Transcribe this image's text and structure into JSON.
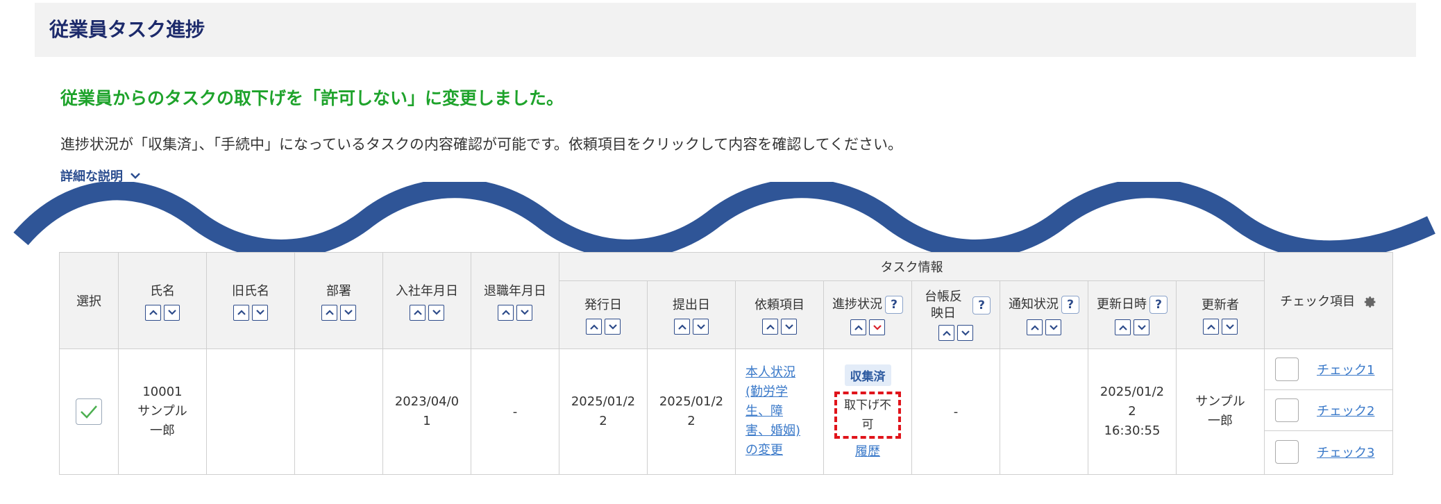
{
  "page": {
    "title": "従業員タスク進捗"
  },
  "message": {
    "success": "従業員からのタスクの取下げを「許可しない」に変更しました。"
  },
  "description": "進捗状況が「収集済」、「手続中」になっているタスクの内容確認が可能です。依頼項目をクリックして内容を確認してください。",
  "detail_link": {
    "label": "詳細な説明"
  },
  "colors": {
    "title": "#1c2a6b",
    "success": "#1ea32b",
    "accent": "#2d4b8a",
    "wave": "#2f5597",
    "dashed": "#e0141b"
  },
  "table": {
    "group_header": "タスク情報",
    "headers": {
      "select": "選択",
      "name": "氏名",
      "old_name": "旧氏名",
      "department": "部署",
      "join_date": "入社年月日",
      "leave_date": "退職年月日",
      "issue_date": "発行日",
      "submit_date": "提出日",
      "request_item": "依頼項目",
      "progress": "進捗状況",
      "ledger": "台帳反映日",
      "notify": "通知状況",
      "updated_at": "更新日時",
      "updater": "更新者",
      "check_items": "チェック項目"
    },
    "help_mark": "?",
    "row": {
      "id_name": "10001\nサンプル\n一郎",
      "old_name": "",
      "department": "",
      "join_date": "2023/04/0\n1",
      "leave_date": "-",
      "issue_date": "2025/01/2\n2",
      "submit_date": "2025/01/2\n2",
      "request_item": "本人状況\n(勤労学\n生、障\n害、婚姻)\nの変更",
      "status_badge": "収集済",
      "withdraw": "取下げ不\n可",
      "history": "履歴",
      "ledger": "-",
      "notify": "",
      "updated_at": "2025/01/2\n2\n16:30:55",
      "updater": "サンプル\n一郎",
      "checks": [
        "チェック1",
        "チェック2",
        "チェック3"
      ]
    }
  }
}
